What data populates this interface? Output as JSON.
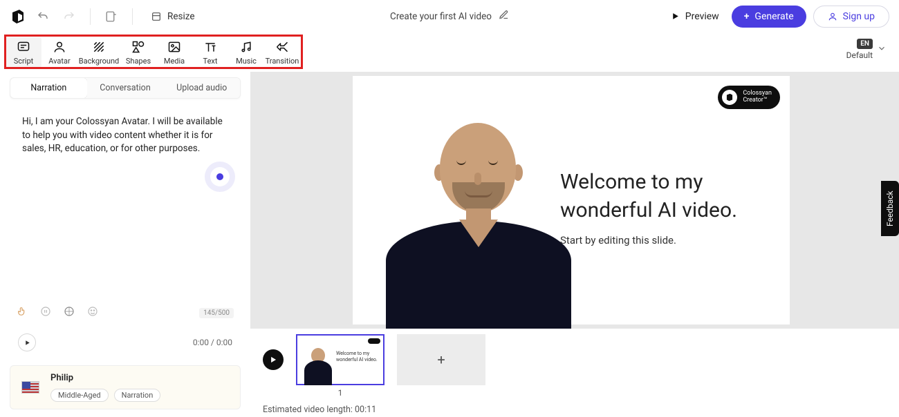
{
  "topbar": {
    "resize_label": "Resize",
    "title": "Create your first AI video",
    "preview_label": "Preview",
    "generate_label": "Generate",
    "signup_label": "Sign up"
  },
  "toolbar": {
    "items": [
      {
        "label": "Script"
      },
      {
        "label": "Avatar"
      },
      {
        "label": "Background"
      },
      {
        "label": "Shapes"
      },
      {
        "label": "Media"
      },
      {
        "label": "Text"
      },
      {
        "label": "Music"
      },
      {
        "label": "Transition"
      }
    ]
  },
  "language": {
    "code": "EN",
    "label": "Default"
  },
  "script_panel": {
    "tabs": {
      "narration": "Narration",
      "conversation": "Conversation",
      "upload": "Upload audio"
    },
    "text": "Hi, I am your Colossyan Avatar. I will be available to help you with video content whether it is for sales, HR, education, or for other purposes.",
    "char_count": "145/500",
    "time": "0:00 / 0:00"
  },
  "voice": {
    "name": "Philip",
    "tags": [
      "Middle-Aged",
      "Narration"
    ]
  },
  "slide": {
    "title_line1": "Welcome to my",
    "title_line2": "wonderful AI video.",
    "subtitle": "Start by editing this slide.",
    "brand_line1": "Colossyan",
    "brand_line2": "Creator™"
  },
  "timeline": {
    "thumb_title1": "Welcome to my",
    "thumb_title2": "wonderful AI video.",
    "slide_number": "1",
    "estimated_label": "Estimated video length:",
    "estimated_value": "00:11"
  },
  "feedback_label": "Feedback"
}
